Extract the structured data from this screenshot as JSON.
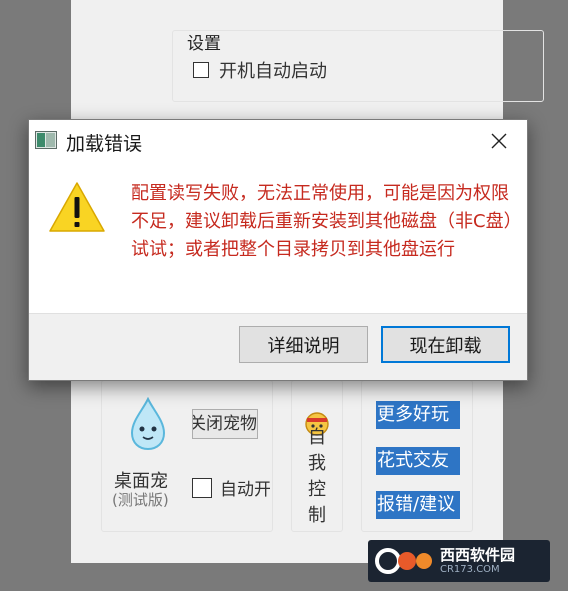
{
  "settings": {
    "title": "设置",
    "autostart_label": "开机自动启动",
    "autostart_checked": false
  },
  "pet": {
    "close_button": "关闭宠物",
    "name": "桌面宠",
    "subtitle": "(测试版)",
    "autostart_label": "自动开",
    "autostart_checked": false
  },
  "self_control": {
    "label": "自我控制"
  },
  "links": [
    "更多好玩",
    "花式交友",
    "报错/建议"
  ],
  "dialog": {
    "title": "加载错误",
    "message": "配置读写失败，无法正常使用，可能是因为权限不足，建议卸载后重新安装到其他磁盘（非C盘）试试；或者把整个目录拷贝到其他盘运行",
    "buttons": {
      "details": "详细说明",
      "uninstall": "现在卸载"
    },
    "message_color": "#c62a1f",
    "accent": "#0078d7"
  },
  "watermark": {
    "main": "西西软件园",
    "sub": "CR173.COM"
  },
  "icons": [
    "app-icon",
    "close-icon",
    "warning-icon",
    "water-drop-icon",
    "emoji-icon"
  ]
}
